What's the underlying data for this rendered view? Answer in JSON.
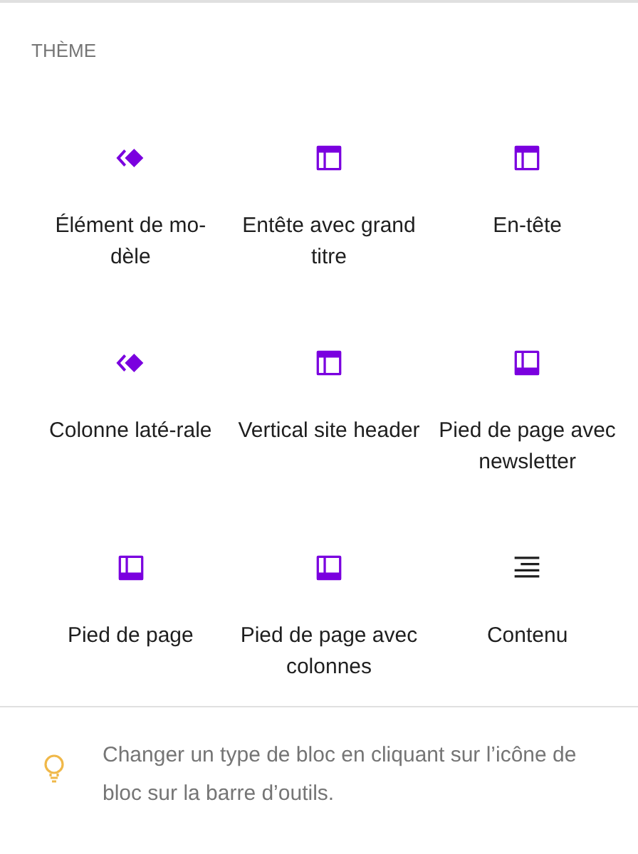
{
  "section": {
    "title": "THÈME"
  },
  "blocks": [
    {
      "label": "Élément de mo-dèle",
      "kind": "template"
    },
    {
      "label": "Entête avec grand titre",
      "kind": "header"
    },
    {
      "label": "En-tête",
      "kind": "header"
    },
    {
      "label": "Colonne laté-rale",
      "kind": "template"
    },
    {
      "label": "Vertical site header",
      "kind": "header"
    },
    {
      "label": "Pied de page avec newsletter",
      "kind": "footer"
    },
    {
      "label": "Pied de page",
      "kind": "footer"
    },
    {
      "label": "Pied de page avec colonnes",
      "kind": "footer"
    },
    {
      "label": "Contenu",
      "kind": "content"
    }
  ],
  "tip": {
    "text": "Changer un type de bloc en cliquant sur l’icône de bloc sur la barre d’outils."
  }
}
